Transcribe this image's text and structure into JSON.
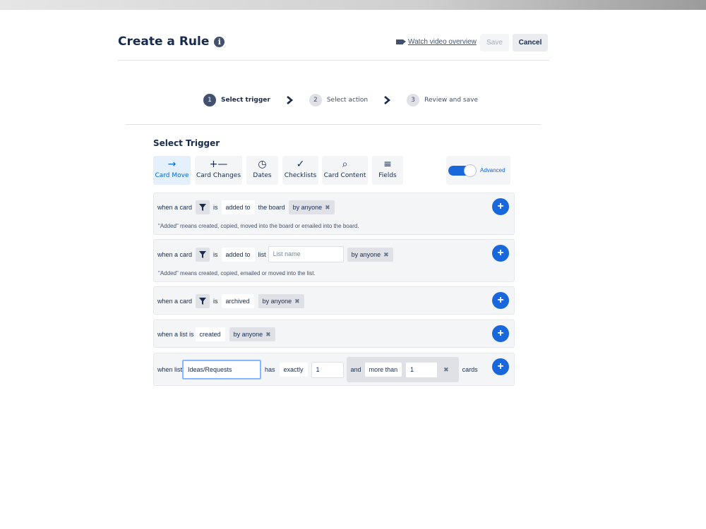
{
  "header": {
    "title": "Create a Rule",
    "video_link": "Watch video overview",
    "save_label": "Save",
    "cancel_label": "Cancel"
  },
  "steps": [
    {
      "num": "1",
      "label": "Select trigger"
    },
    {
      "num": "2",
      "label": "Select action"
    },
    {
      "num": "3",
      "label": "Review and save"
    }
  ],
  "section_title": "Select Trigger",
  "tabs": [
    {
      "icon": "→",
      "label": "Card Move"
    },
    {
      "icon": "+—",
      "label": "Card Changes"
    },
    {
      "icon": "◷",
      "label": "Dates"
    },
    {
      "icon": "✓",
      "label": "Checklists"
    },
    {
      "icon": "⌕",
      "label": "Card Content"
    },
    {
      "icon": "≡",
      "label": "Fields"
    }
  ],
  "advanced_label": "Advanced",
  "triggers": {
    "t1": {
      "when_card": "when a card",
      "is": "is",
      "action": "added to",
      "the_board": "the board",
      "by_anyone": "by anyone",
      "hint": "\"Added\" means created, copied, moved into the board or emailed into the board."
    },
    "t2": {
      "when_card": "when a card",
      "is": "is",
      "action": "added to",
      "list": "list",
      "list_placeholder": "List name",
      "by_anyone": "by anyone",
      "hint": "\"Added\" means created, copied, emailed or moved into the list."
    },
    "t3": {
      "when_card": "when a card",
      "is": "is",
      "action": "archived",
      "by_anyone": "by anyone"
    },
    "t4": {
      "when_list_is": "when a list is",
      "action": "created",
      "by_anyone": "by anyone"
    },
    "t5": {
      "when_list": "when list",
      "list_value": "Ideas/Requests",
      "has": "has",
      "exactly": "exactly",
      "count": "1",
      "and": "and",
      "more_than": "more than",
      "more_count": "1",
      "cards": "cards"
    }
  },
  "colors": {
    "accent": "#1868db",
    "panel": "#f4f5f7",
    "active_tab": "#e4f0fb"
  }
}
